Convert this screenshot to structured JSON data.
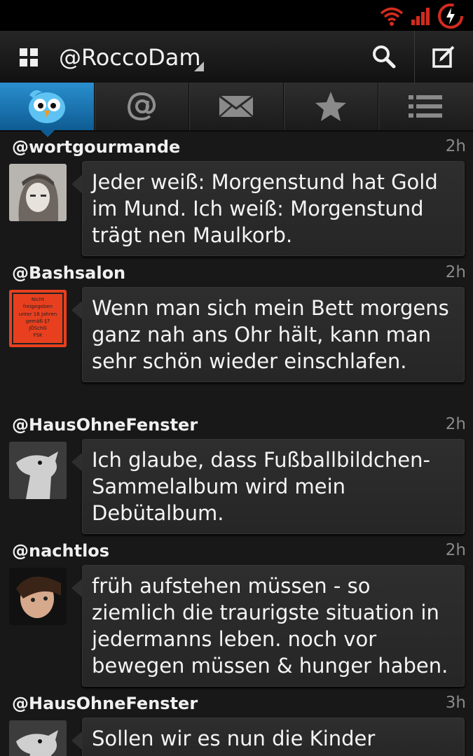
{
  "statusbar": {
    "icons": [
      "wifi-icon",
      "signal-icon",
      "battery-charging-icon"
    ]
  },
  "actionbar": {
    "account": "@RoccoDam",
    "icons": [
      "grid-icon",
      "search-icon",
      "compose-icon"
    ]
  },
  "tabs": [
    {
      "name": "timeline",
      "icon": "bird-icon",
      "active": true
    },
    {
      "name": "mentions",
      "icon": "at-icon"
    },
    {
      "name": "messages",
      "icon": "envelope-icon"
    },
    {
      "name": "favorites",
      "icon": "star-icon"
    },
    {
      "name": "lists",
      "icon": "list-icon"
    }
  ],
  "tweets": [
    {
      "user": "@wortgourmande",
      "time": "2h",
      "text": "Jeder weiß: Morgenstund hat Gold im Mund. Ich weiß: Morgenstund trägt nen Maulkorb."
    },
    {
      "user": "@Bashsalon",
      "time": "2h",
      "text": "Wenn man sich mein Bett morgens ganz nah ans Ohr hält, kann man sehr schön wieder einschlafen.",
      "avatar_label": {
        "line1": "Nicht",
        "line2": "freigegeben",
        "line3": "unter 18 Jahren",
        "line4": "gemäß §7",
        "line5": "JÖSchG",
        "line6": "FSK"
      }
    },
    {
      "user": "@HausOhneFenster",
      "time": "2h",
      "text": "Ich glaube, dass Fußballbildchen-Sammelalbum wird mein Debütalbum."
    },
    {
      "user": "@nachtlos",
      "time": "2h",
      "text": "früh aufstehen müssen - so ziemlich die traurigste situation in jedermanns leben. noch vor bewegen müssen & hunger haben."
    },
    {
      "user": "@HausOhneFenster",
      "time": "3h",
      "text": "Sollen wir es nun die Kinder"
    }
  ],
  "colors": {
    "accent": "#1d7fc0",
    "background": "#181818",
    "bubble": "#2b2b2b"
  }
}
